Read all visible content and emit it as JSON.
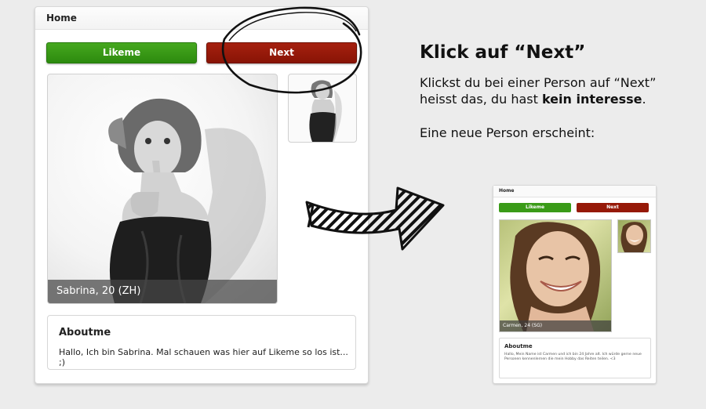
{
  "main_card": {
    "header_title": "Home",
    "like_label": "Likeme",
    "next_label": "Next",
    "photo_caption": "Sabrina, 20 (ZH)",
    "about_title": "Aboutme",
    "about_text": "Hallo, Ich bin Sabrina. Mal schauen was hier auf Likeme so los ist... ;)"
  },
  "explanation": {
    "headline": "Klick auf “Next”",
    "para_part1": "Klickst du bei einer Person auf “Next” heisst das, du hast ",
    "para_bold": "kein interesse",
    "para_part2": ".",
    "para2": "Eine neue Person erscheint:"
  },
  "mini_card": {
    "header_title": "Home",
    "like_label": "Likeme",
    "next_label": "Next",
    "photo_caption": "Carmen, 24 (SG)",
    "about_title": "Aboutme",
    "about_text": "Hallo, Mein Name ist Carmen und ich bin 24 Jahre alt. Ich würde gerne neue Personen kennenlernen die mein Hobby das Reiten teilen. <3"
  },
  "colors": {
    "like_green": "#3a9b18",
    "next_red": "#961908",
    "background": "#ececec"
  }
}
